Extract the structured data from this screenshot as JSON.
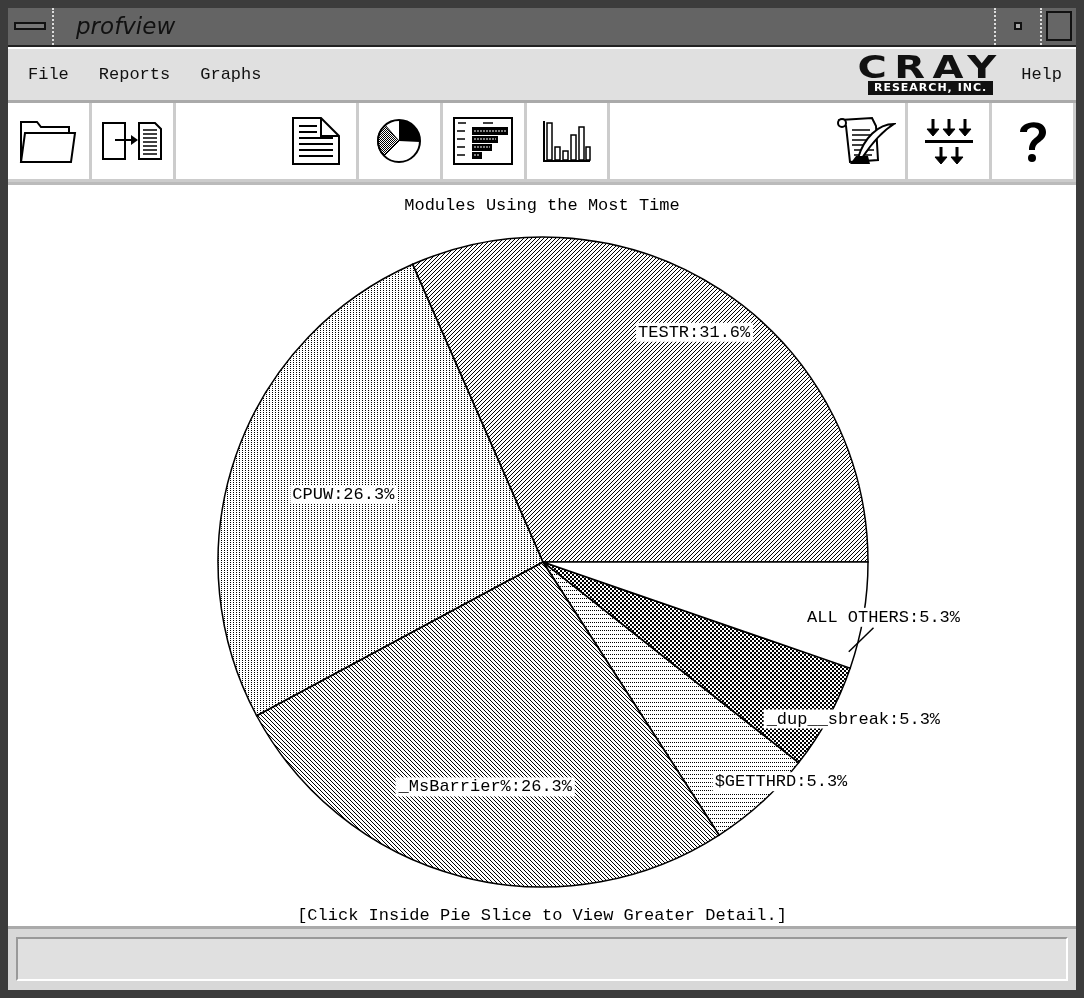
{
  "window": {
    "title": "profview"
  },
  "menu_bar": {
    "items": [
      "File",
      "Reports",
      "Graphs"
    ],
    "logo": {
      "name": "CRAY",
      "subtitle": "RESEARCH, INC."
    },
    "help": "Help"
  },
  "chart_panel": {
    "chart_data": {
      "type": "pie",
      "title": "Modules Using the Most Time",
      "categories": [
        "TESTR",
        "CPUW",
        "_MsBarrier%",
        "$GETTHRD",
        "_dup__sbreak",
        "ALL OTHERS"
      ],
      "values": [
        31.6,
        26.3,
        26.3,
        5.3,
        5.3,
        5.3
      ],
      "value_labels": [
        ":31.6%",
        ":26.3%",
        ":26.3%",
        ":5.3%",
        ":5.3%",
        ":5.3%"
      ]
    },
    "hint": "[Click Inside Pie Slice to View Greater Detail.]"
  }
}
